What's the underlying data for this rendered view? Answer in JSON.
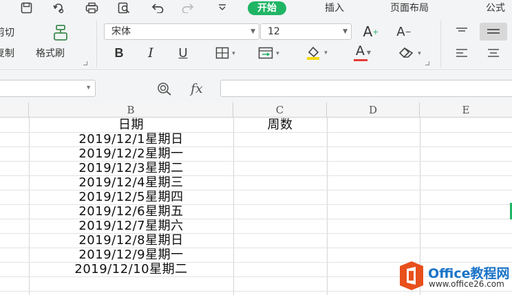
{
  "quick_access": {
    "icons": [
      "save-icon",
      "undo-history-icon",
      "print-icon",
      "print-preview-icon",
      "undo-icon",
      "redo-icon",
      "customize-dropdown-icon"
    ]
  },
  "tabs": [
    {
      "label": "开始",
      "active": true
    },
    {
      "label": "插入",
      "active": false
    },
    {
      "label": "页面布局",
      "active": false
    },
    {
      "label": "公式",
      "active": false
    }
  ],
  "ribbon": {
    "cut_label": "剪切",
    "copy_label": "复制",
    "format_painter_label": "格式刷",
    "font_name": "宋体",
    "font_size": "12",
    "increase_font_glyph": "A",
    "decrease_font_glyph": "A",
    "bold_glyph": "B",
    "italic_glyph": "I",
    "underline_glyph": "U",
    "font_color_glyph": "A",
    "font_color": "#e53935",
    "fill_color": "#f5d90a"
  },
  "formula_bar": {
    "name_box_value": "",
    "fx_label": "fx",
    "formula_value": ""
  },
  "sheet": {
    "columns": [
      "B",
      "C",
      "D",
      "E"
    ],
    "header_row": {
      "B": "日期",
      "C": "周数"
    },
    "rows": [
      "2019/12/1星期日",
      "2019/12/2星期一",
      "2019/12/3星期二",
      "2019/12/4星期三",
      "2019/12/5星期四",
      "2019/12/6星期五",
      "2019/12/7星期六",
      "2019/12/8星期日",
      "2019/12/9星期一",
      "2019/12/10星期二"
    ]
  },
  "watermark": {
    "title": "Office教程网",
    "url": "www.office26.com",
    "logo_color": "#e8501c"
  },
  "accent_color": "#1fb565"
}
